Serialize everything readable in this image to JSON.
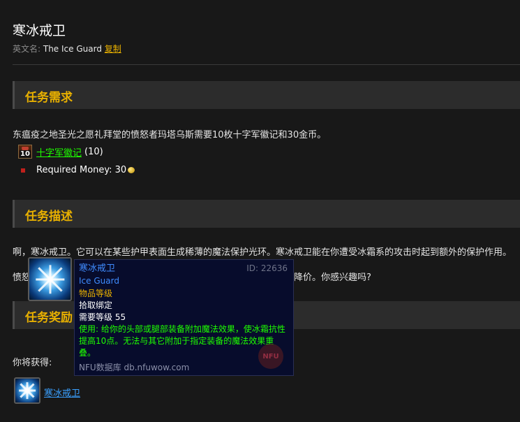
{
  "page": {
    "title": "寒冰戒卫",
    "en_label": "英文名:",
    "en_name": "The Ice Guard",
    "copy_label": "复制"
  },
  "requirements": {
    "heading": "任务需求",
    "text": "东瘟疫之地圣光之愿礼拜堂的愤怒者玛塔乌斯需要10枚十字军徽记和30金币。",
    "item_count": "10",
    "item_name": "十字军徽记",
    "item_qty": "(10)",
    "money_label": "Required Money: 30"
  },
  "description": {
    "heading": "任务描述",
    "line1": "啊，寒冰戒卫。它可以在某些护甲表面生成稀薄的魔法保护光环。寒冰戒卫能在你遭受冰霜系的攻击时起到额外的保护作用。",
    "line2_start": "愤怒",
    "line2_end": "降价。你感兴趣吗?"
  },
  "rewards": {
    "heading": "任务奖励",
    "you_get": "你将获得:",
    "item_name": "寒冰戒卫"
  },
  "tooltip": {
    "name": "寒冰戒卫",
    "id": "ID: 22636",
    "en_name": "Ice Guard",
    "item_level": "物品等级",
    "bind": "拾取绑定",
    "req_level": "需要等级 55",
    "use_text": "使用: 给你的头部或腿部装备附加魔法效果，使冰霜抗性提高10点。无法与其它附加于指定装备的魔法效果重叠。",
    "source": "NFU数据库 db.nfuwow.com",
    "watermark": "NFU"
  }
}
